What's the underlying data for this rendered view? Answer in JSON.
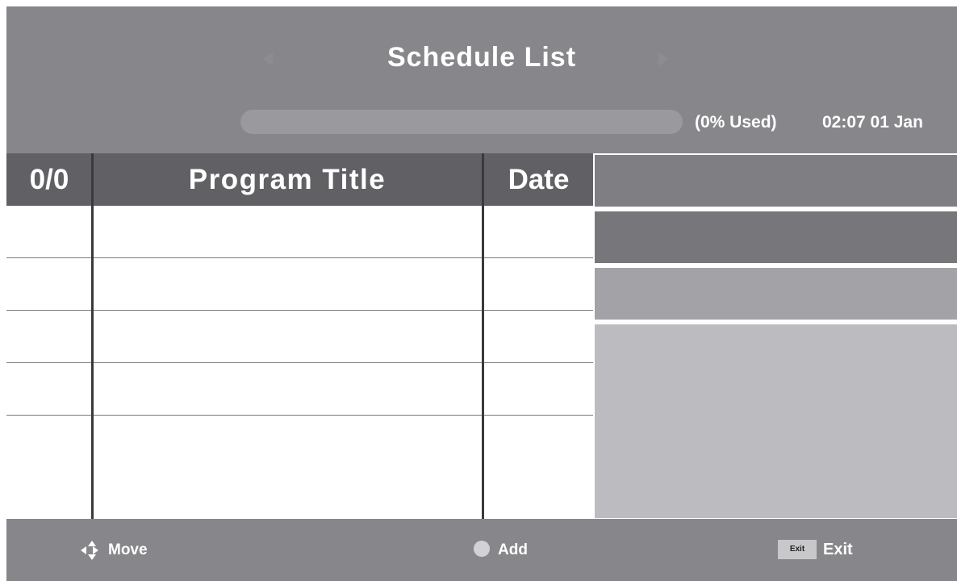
{
  "header": {
    "title": "Schedule List",
    "usage_text": "(0% Used)",
    "usage_percent": 0,
    "clock": "02:07 01 Jan"
  },
  "table": {
    "columns": [
      "0/0",
      "Program Title",
      "Date"
    ],
    "rows": [
      {
        "index": "",
        "title": "",
        "date": ""
      },
      {
        "index": "",
        "title": "",
        "date": ""
      },
      {
        "index": "",
        "title": "",
        "date": ""
      },
      {
        "index": "",
        "title": "",
        "date": ""
      },
      {
        "index": "",
        "title": "",
        "date": ""
      }
    ]
  },
  "footer": {
    "move_label": "Move",
    "add_label": "Add",
    "exit_key_label": "Exit",
    "exit_label": "Exit"
  },
  "icons": {
    "move": "directional-arrows-icon",
    "add": "circle-icon",
    "exit": "exit-key-icon"
  },
  "colors": {
    "header_bg": "#87878b",
    "table_header_bg": "#616165",
    "row_bg": "#ffffff",
    "panel_bg": "#bcbcc0"
  }
}
